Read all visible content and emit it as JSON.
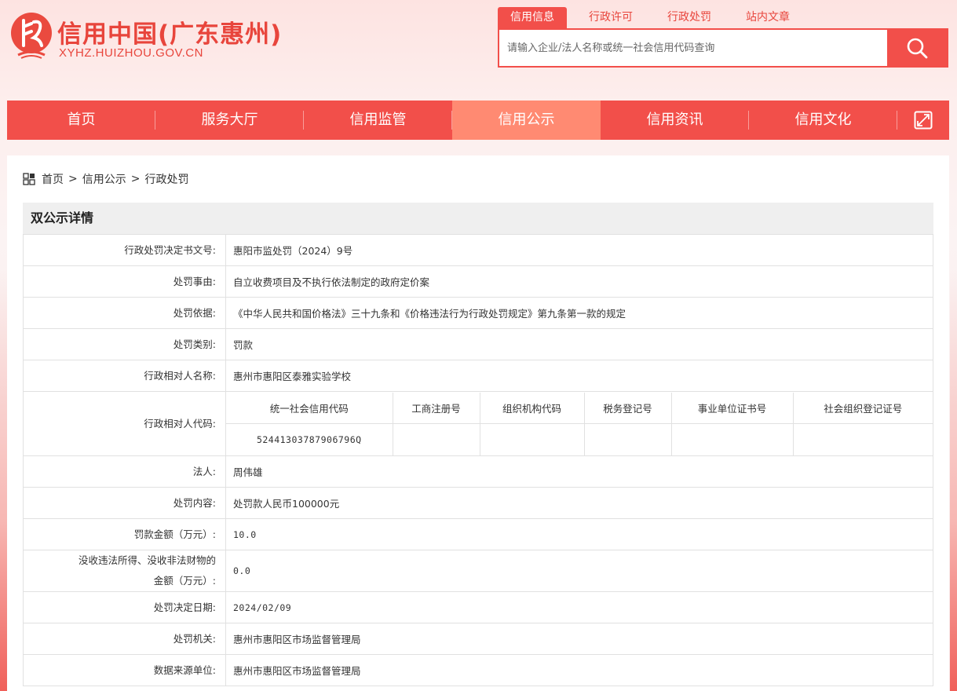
{
  "header": {
    "site_title": "信用中国(广东惠州)",
    "site_domain": "XYHZ.HUIZHOU.GOV.CN"
  },
  "search": {
    "tabs": [
      {
        "label": "信用信息",
        "active": true
      },
      {
        "label": "行政许可",
        "active": false
      },
      {
        "label": "行政处罚",
        "active": false
      },
      {
        "label": "站内文章",
        "active": false
      }
    ],
    "placeholder": "请输入企业/法人名称或统一社会信用代码查询",
    "button_icon": "search-icon"
  },
  "nav": {
    "items": [
      {
        "label": "首页",
        "active": false
      },
      {
        "label": "服务大厅",
        "active": false
      },
      {
        "label": "信用监管",
        "active": false
      },
      {
        "label": "信用公示",
        "active": true
      },
      {
        "label": "信用资讯",
        "active": false
      },
      {
        "label": "信用文化",
        "active": false
      }
    ],
    "expand_icon": "expand-icon"
  },
  "breadcrumb": {
    "icon": "grid-icon",
    "items": [
      "首页",
      "信用公示",
      "行政处罚"
    ],
    "separator": ">"
  },
  "panel": {
    "title": "双公示详情"
  },
  "detail": {
    "decision_no_label": "行政处罚决定书文号:",
    "decision_no": "惠阳市监处罚（2024）9号",
    "reason_label": "处罚事由:",
    "reason": "自立收费项目及不执行依法制定的政府定价案",
    "basis_label": "处罚依据:",
    "basis": "《中华人民共和国价格法》三十九条和《价格违法行为行政处罚规定》第九条第一款的规定",
    "category_label": "处罚类别:",
    "category": "罚款",
    "party_name_label": "行政相对人名称:",
    "party_name": "惠州市惠阳区泰雅实验学校",
    "party_code_label": "行政相对人代码:",
    "code_headers": [
      "统一社会信用代码",
      "工商注册号",
      "组织机构代码",
      "税务登记号",
      "事业单位证书号",
      "社会组织登记证号"
    ],
    "code_values": [
      "52441303787906796Q",
      "",
      "",
      "",
      "",
      ""
    ],
    "legal_person_label": "法人:",
    "legal_person": "周伟雄",
    "content_label": "处罚内容:",
    "content": "处罚款人民币100000元",
    "fine_label": "罚款金额（万元）:",
    "fine": "10.0",
    "confiscation_label_1": "没收违法所得、没收非法财物的",
    "confiscation_label_2": "金额（万元）:",
    "confiscation": "0.0",
    "decision_date_label": "处罚决定日期:",
    "decision_date": "2024/02/09",
    "authority_label": "处罚机关:",
    "authority": "惠州市惠阳区市场监督管理局",
    "source_label": "数据来源单位:",
    "source": "惠州市惠阳区市场监督管理局"
  },
  "colors": {
    "brand_red": "#f24f4a",
    "nav_active": "#ff8a72",
    "panel_header_bg": "#efefef"
  }
}
